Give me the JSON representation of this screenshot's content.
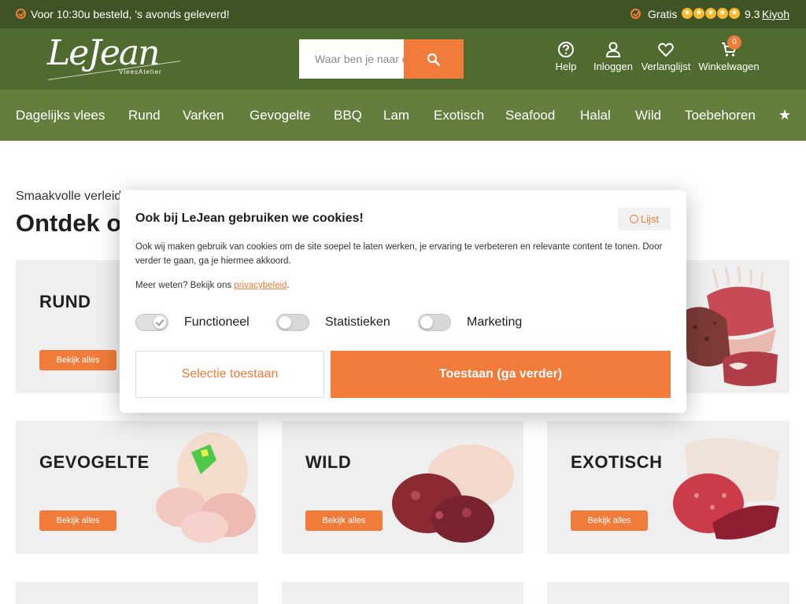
{
  "colors": {
    "topbar_bg": "#3f5425",
    "header_bg": "#506b2f",
    "nav_bg": "#647e3d",
    "accent": "#f07b3a",
    "tile_bg": "#efefef"
  },
  "topbar": {
    "left_text": "Voor 10:30u besteld, 's avonds geleverd!",
    "gratis": "Gratis",
    "rating_stars": 5,
    "score": "9.3",
    "kiyoh": "Kiyoh"
  },
  "header": {
    "logo_main": "LeJean",
    "logo_sub": "VleesAtelier",
    "search_placeholder": "Waar ben je naar op zoek?",
    "help": "Help",
    "login": "Inloggen",
    "wishlist": "Verlanglijst",
    "cart": "Winkelwagen",
    "cart_count": "0"
  },
  "nav": {
    "items": [
      "Dagelijks vlees",
      "Rund",
      "Varken",
      "Gevogelte",
      "BBQ",
      "Lam",
      "Exotisch",
      "Seafood",
      "Halal",
      "Wild",
      "Toebehoren"
    ],
    "more_icon": "star-icon"
  },
  "content": {
    "subtitle": "Smaakvolle verleiding",
    "title": "Ontdek onze categorieën"
  },
  "tiles": [
    {
      "name": "RUND",
      "button": "Bekijk alles"
    },
    {
      "name": "GEVOGELTE",
      "button": "Bekijk alles"
    },
    {
      "name": "WILD",
      "button": "Bekijk alles"
    },
    {
      "name": "EXOTISCH",
      "button": "Bekijk alles"
    }
  ],
  "cookie": {
    "title": "Ook bij LeJean gebruiken we cookies!",
    "list_button": "Lijst",
    "text": "Ook wij maken gebruik van cookies om de site soepel te laten werken, je ervaring te verbeteren en relevante content te tonen. Door verder te gaan, ga je hiermee akkoord.",
    "more_prefix": "Meer weten? Bekijk ons ",
    "more_link": "privacybeleid",
    "more_suffix": ".",
    "toggles": [
      {
        "label": "Functioneel",
        "on": true
      },
      {
        "label": "Statistieken",
        "on": false
      },
      {
        "label": "Marketing",
        "on": false
      }
    ],
    "btn_selection": "Selectie toestaan",
    "btn_allow": "Toestaan (ga verder)"
  }
}
